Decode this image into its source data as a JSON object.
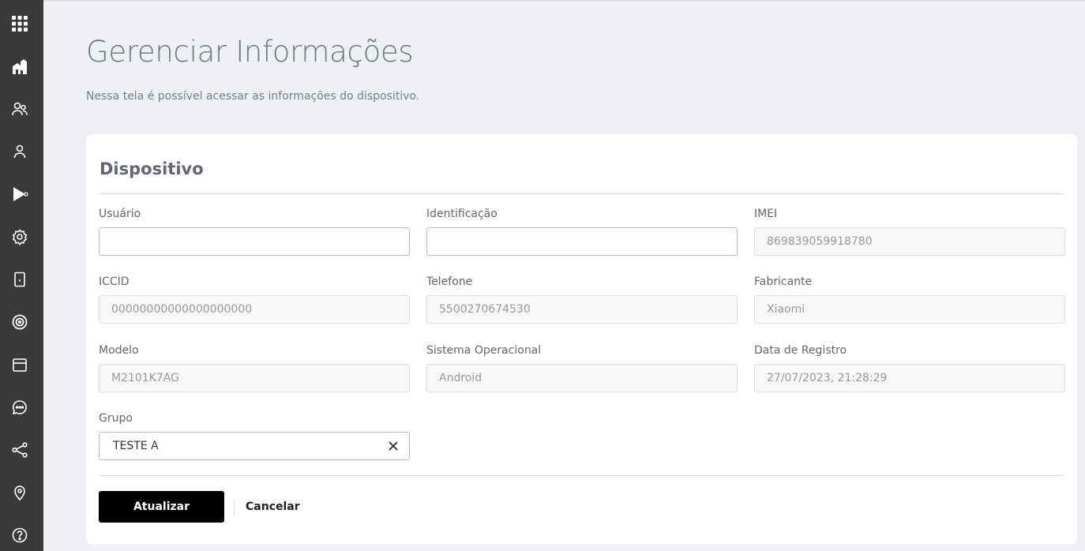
{
  "sidebar": {
    "items": [
      {
        "icon": "apps-grid-icon"
      },
      {
        "icon": "home-buildings-icon"
      },
      {
        "icon": "users-group-icon"
      },
      {
        "icon": "user-icon"
      },
      {
        "icon": "play-send-icon"
      },
      {
        "icon": "settings-gear-icon"
      },
      {
        "icon": "device-icon"
      },
      {
        "icon": "radar-icon"
      },
      {
        "icon": "calendar-window-icon"
      },
      {
        "icon": "chat-bubble-icon"
      },
      {
        "icon": "share-icon"
      },
      {
        "icon": "location-pin-icon"
      },
      {
        "icon": "help-icon"
      }
    ]
  },
  "page": {
    "title": "Gerenciar Informações",
    "subtitle": "Nessa tela é possível acessar as informações do dispositivo."
  },
  "card": {
    "title": "Dispositivo",
    "fields": {
      "usuario": {
        "label": "Usuário",
        "value": ""
      },
      "identificacao": {
        "label": "Identificação",
        "value": ""
      },
      "imei": {
        "label": "IMEI",
        "value": "869839059918780"
      },
      "iccid": {
        "label": "ICCID",
        "value": "00000000000000000000"
      },
      "telefone": {
        "label": "Telefone",
        "value": "5500270674530"
      },
      "fabricante": {
        "label": "Fabricante",
        "value": "Xiaomi"
      },
      "modelo": {
        "label": "Modelo",
        "value": "M2101K7AG"
      },
      "sistema": {
        "label": "Sistema Operacional",
        "value": "Android"
      },
      "registro": {
        "label": "Data de Registro",
        "value": "27/07/2023, 21:28:29"
      },
      "grupo": {
        "label": "Grupo",
        "value": "TESTE A"
      }
    },
    "actions": {
      "update_label": "Atualizar",
      "cancel_label": "Cancelar"
    }
  },
  "colors": {
    "sidebar_bg": "#3a3a3a",
    "page_bg": "#eff0f4",
    "primary_button": "#000000"
  }
}
